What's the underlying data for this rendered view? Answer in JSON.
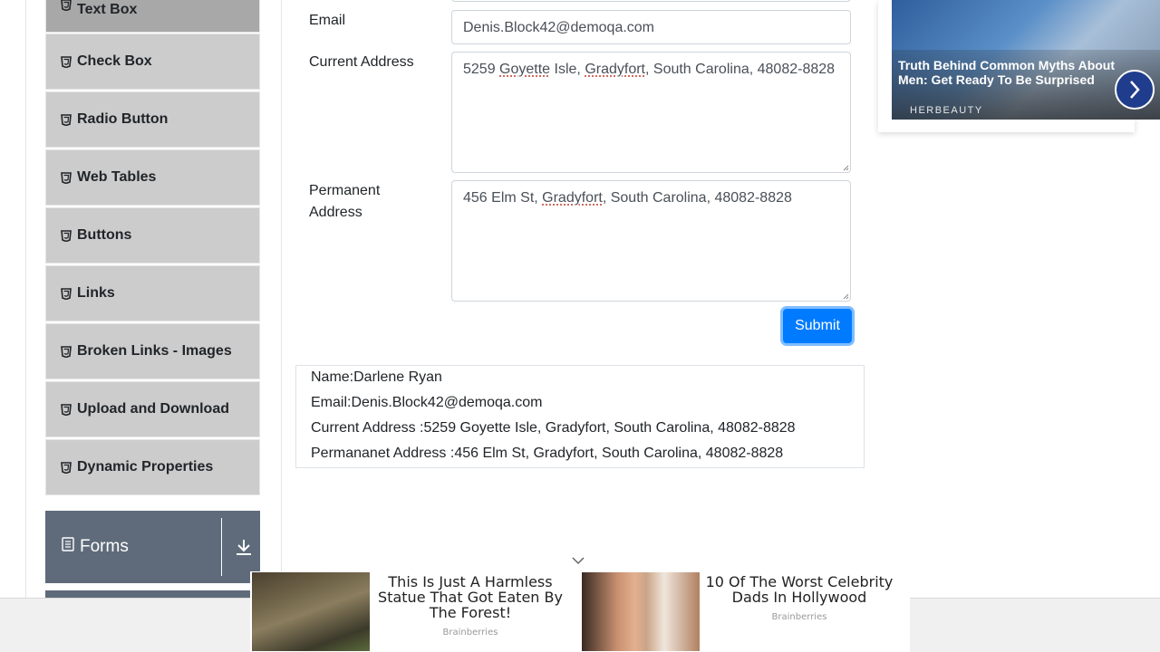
{
  "sidebar": {
    "items": [
      {
        "label": "Text Box",
        "active": true
      },
      {
        "label": "Check Box"
      },
      {
        "label": "Radio Button"
      },
      {
        "label": "Web Tables"
      },
      {
        "label": "Buttons"
      },
      {
        "label": "Links"
      },
      {
        "label": "Broken Links - Images"
      },
      {
        "label": "Upload and Download"
      },
      {
        "label": "Dynamic Properties"
      }
    ],
    "group": {
      "label": "Forms",
      "icon": "document-icon",
      "toggle_icon": "download-arrow-icon"
    }
  },
  "form": {
    "email": {
      "label": "Email",
      "value": "Denis.Block42@demoqa.com"
    },
    "current_address": {
      "label": "Current Address",
      "value_parts": [
        "5259 ",
        "Goyette",
        " Isle, ",
        "Gradyfort",
        ", South Carolina, 48082-8828"
      ]
    },
    "permanent_address": {
      "label_line1": "Permanent",
      "label_line2": "Address",
      "value_parts": [
        "456 Elm St, ",
        "Gradyfort",
        ", South Carolina, 48082-8828"
      ]
    },
    "submit_label": "Submit"
  },
  "output": {
    "name": "Name:Darlene Ryan",
    "email": "Email:Denis.Block42@demoqa.com",
    "current": "Current Address :5259 Goyette Isle, Gradyfort, South Carolina, 48082-8828",
    "permanent": "Permananet Address :456 Elm St, Gradyfort, South Carolina, 48082-8828"
  },
  "ad_top": {
    "title": "Truth Behind Common Myths About Men: Get Ready To Be Surprised",
    "source": "HERBEAUTY"
  },
  "ad_bottom": {
    "items": [
      {
        "headline": "This Is Just A Harmless Statue That Got Eaten By The Forest!",
        "source": "Brainberries"
      },
      {
        "headline": "10 Of The Worst Celebrity Dads In Hollywood",
        "source": "Brainberries"
      }
    ]
  },
  "colors": {
    "accent": "#007bff",
    "sidebar_item": "#cccccc",
    "group_header": "#5f6b7a"
  }
}
